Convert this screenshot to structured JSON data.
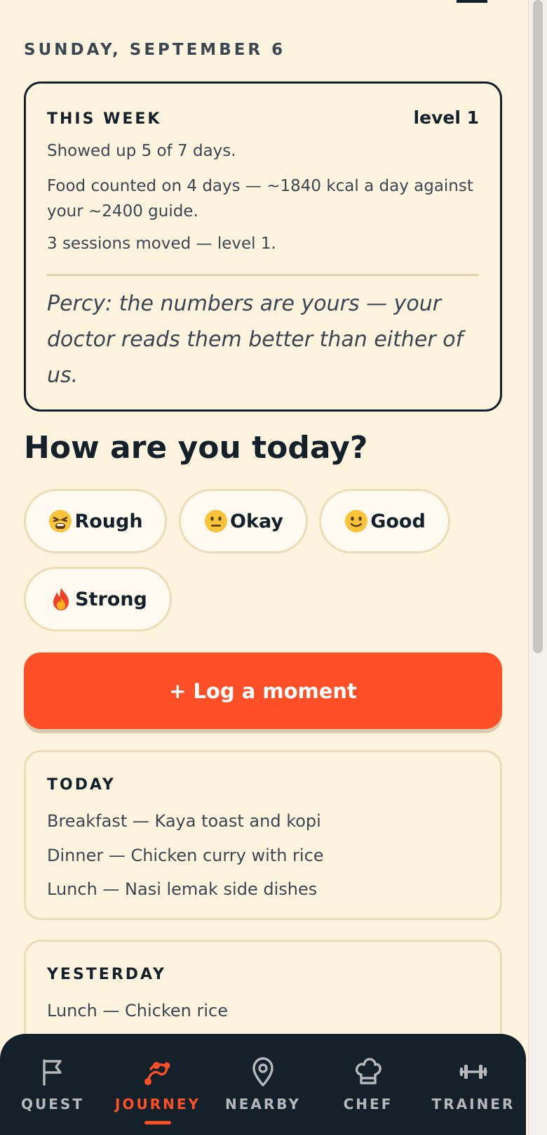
{
  "header": {
    "date": "SUNDAY, SEPTEMBER 6"
  },
  "week_card": {
    "title": "THIS WEEK",
    "level": "level 1",
    "lines": [
      "Showed up 5 of 7 days.",
      "Food counted on 4 days — ~1840 kcal a day against your ~2400 guide.",
      "3 sessions moved — level 1."
    ],
    "quote": "Percy: the numbers are yours — your doctor reads them better than either of us."
  },
  "mood": {
    "heading": "How are you today?",
    "options": [
      {
        "label": "Rough",
        "icon": "tired-face-emoji"
      },
      {
        "label": "Okay",
        "icon": "neutral-face-emoji"
      },
      {
        "label": "Good",
        "icon": "slight-smile-emoji"
      },
      {
        "label": "Strong",
        "icon": "fire-emoji"
      }
    ]
  },
  "log_button": {
    "label": "+ Log a moment"
  },
  "today": {
    "title": "TODAY",
    "items": [
      "Breakfast — Kaya toast and kopi",
      "Dinner — Chicken curry with rice",
      "Lunch — Nasi lemak side dishes"
    ]
  },
  "yesterday": {
    "title": "YESTERDAY",
    "items": [
      "Lunch — Chicken rice"
    ]
  },
  "nav": {
    "items": [
      {
        "label": "QUEST",
        "icon": "flag-icon",
        "active": false
      },
      {
        "label": "JOURNEY",
        "icon": "route-icon",
        "active": true
      },
      {
        "label": "NEARBY",
        "icon": "map-pin-icon",
        "active": false
      },
      {
        "label": "CHEF",
        "icon": "chef-hat-icon",
        "active": false
      },
      {
        "label": "TRAINER",
        "icon": "dumbbell-icon",
        "active": false
      }
    ]
  },
  "colors": {
    "background": "#fdf3df",
    "accent": "#fe4f27",
    "ink": "#14212a",
    "card_border": "#eddcb8"
  }
}
